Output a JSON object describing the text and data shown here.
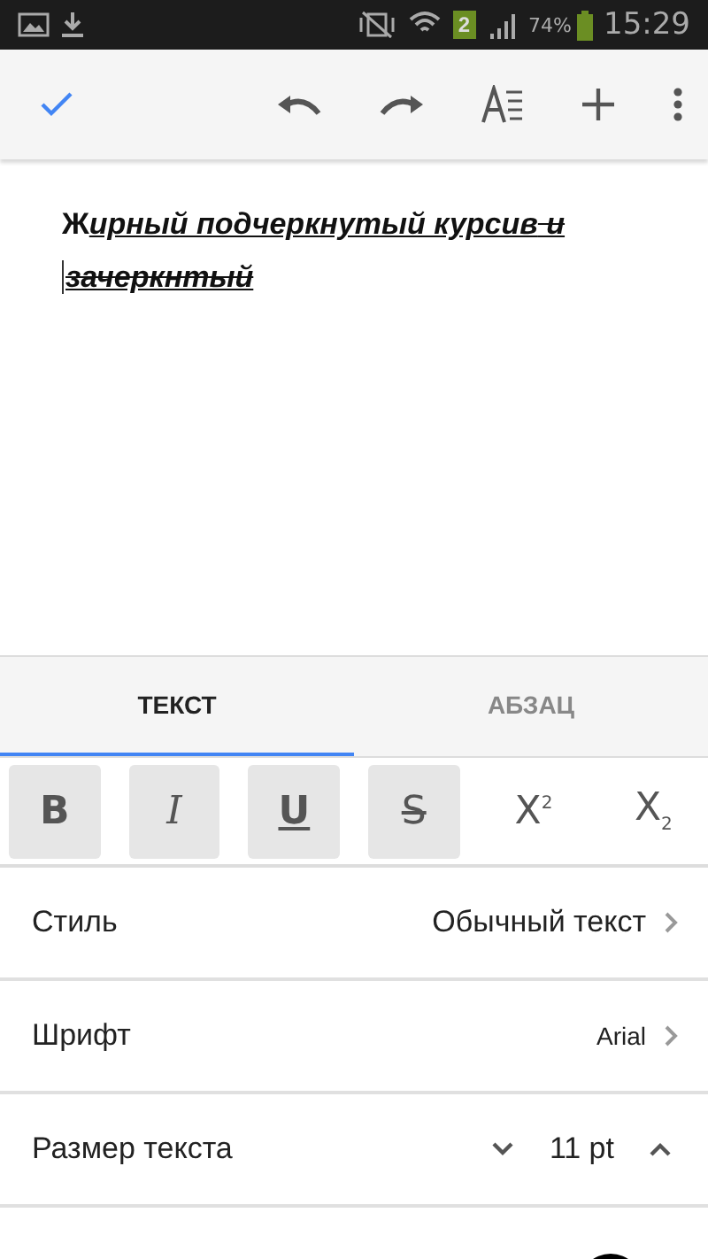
{
  "status_bar": {
    "battery": "74%",
    "time": "15:29",
    "sim": "2"
  },
  "document": {
    "runs": [
      {
        "text": "Ж",
        "bold": true,
        "italic": false,
        "underline": false,
        "strike": false,
        "cursor_before": false
      },
      {
        "text": "ирный подчеркнутый курсив",
        "bold": true,
        "italic": true,
        "underline": true,
        "strike": false,
        "cursor_before": false
      },
      {
        "text": " и ",
        "bold": true,
        "italic": true,
        "underline": true,
        "strike": true,
        "cursor_before": false
      },
      {
        "text": "зачеркнтый",
        "bold": true,
        "italic": true,
        "underline": true,
        "strike": true,
        "cursor_before": true
      }
    ]
  },
  "tabs": [
    {
      "label": "ТЕКСТ",
      "selected": true
    },
    {
      "label": "АБЗАЦ",
      "selected": false
    }
  ],
  "format_buttons": [
    {
      "kind": "bold",
      "label": "B",
      "selected": true
    },
    {
      "kind": "italic",
      "label": "I",
      "selected": true
    },
    {
      "kind": "underline",
      "label": "U",
      "selected": true
    },
    {
      "kind": "strike",
      "label": "S",
      "selected": true
    },
    {
      "kind": "superscript",
      "label": "X",
      "mark": "2",
      "selected": false
    },
    {
      "kind": "subscript",
      "label": "X",
      "mark": "2",
      "selected": false
    }
  ],
  "settings": [
    {
      "kind": "link",
      "label": "Стиль",
      "value": "Обычный текст"
    },
    {
      "kind": "link",
      "label": "Шрифт",
      "value": "Arial"
    },
    {
      "kind": "stepper",
      "label": "Размер текста",
      "value": "11 pt"
    },
    {
      "kind": "swatch",
      "color": "#000000"
    }
  ]
}
